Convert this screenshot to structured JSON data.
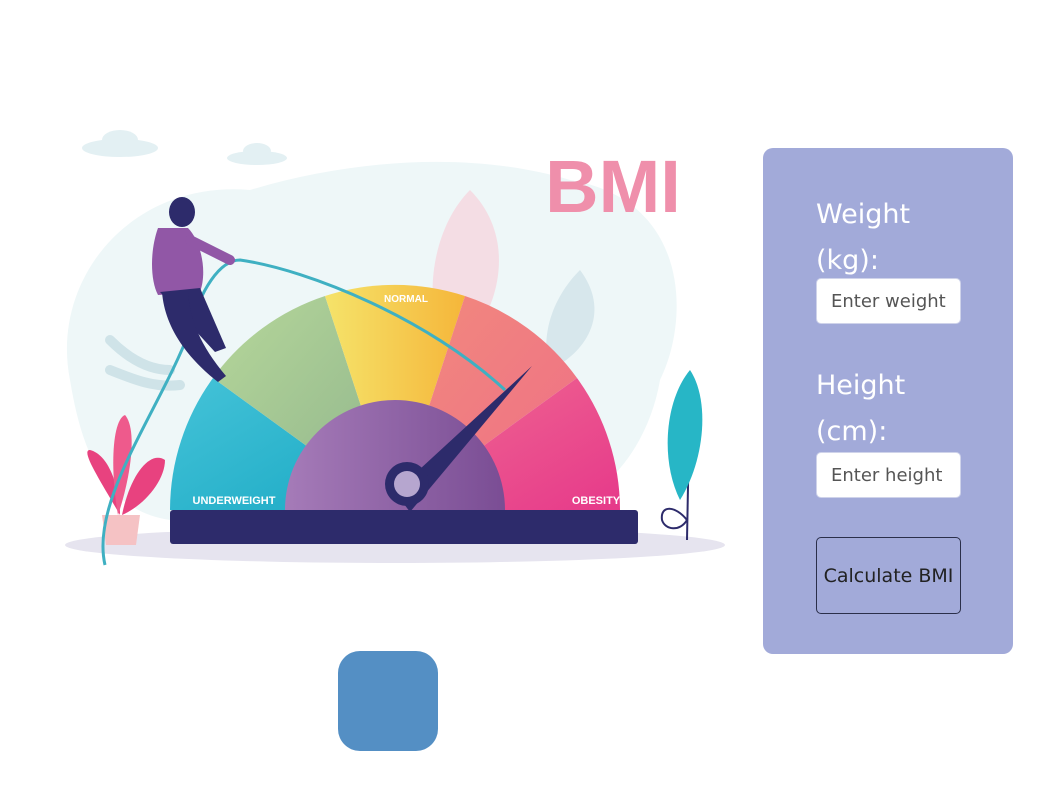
{
  "illustration": {
    "title": "BMI",
    "gauge_labels": {
      "underweight": "UNDERWEIGHT",
      "normal": "NORMAL",
      "obesity": "OBESITY"
    },
    "colors": {
      "title": "#ef8fab",
      "gauge_base": "#2d2b6b",
      "needle": "#2d2b6b"
    }
  },
  "form": {
    "weight_label": "Weight (kg):",
    "weight_placeholder": "Enter weight",
    "height_label": "Height (cm):",
    "height_placeholder": "Enter height",
    "calculate_label": "Calculate BMI",
    "colors": {
      "card_background": "#a2aad9",
      "label_text": "#ffffff"
    }
  },
  "extra": {
    "square_color": "#548fc4"
  }
}
